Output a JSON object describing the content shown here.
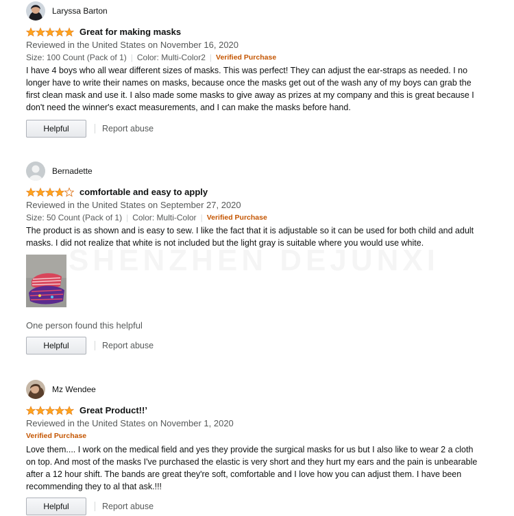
{
  "reviews": [
    {
      "reviewer": "Laryssa Barton",
      "rating": 5,
      "title": "Great for making masks",
      "reviewed": "Reviewed in the United States on November 16, 2020",
      "size": "Size: 100 Count (Pack of 1)",
      "color": "Color: Multi-Color2",
      "verified": "Verified Purchase",
      "body": "I have 4 boys who all wear different sizes of masks. This was perfect! They can adjust the ear-straps as needed. I no longer have to write their names on masks, because once the masks get out of the wash any of my boys can grab the first clean mask and use it. I also made some masks to give away as prizes at my company and this is great because I don't need the winner's exact measurements, and I can make the masks before hand.",
      "helpful_label": "Helpful",
      "report_label": "Report abuse"
    },
    {
      "reviewer": "Bernadette",
      "rating": 4,
      "title": "comfortable and easy to apply",
      "reviewed": "Reviewed in the United States on September 27, 2020",
      "size": "Size: 50 Count (Pack of 1)",
      "color": "Color: Multi-Color",
      "verified": "Verified Purchase",
      "body": "The product is as shown and is easy to sew. I like the fact that it is adjustable so it can be used for both child and adult masks. I did not realize that white is not included but the light gray is suitable where you would use white.",
      "helpful_count": "One person found this helpful",
      "helpful_label": "Helpful",
      "report_label": "Report abuse"
    },
    {
      "reviewer": "Mz Wendee",
      "rating": 5,
      "title": "Great Product!!’",
      "reviewed": "Reviewed in the United States on November 1, 2020",
      "verified": "Verified Purchase",
      "body": "Love them.... I work on the medical field and yes they provide the surgical masks for us but I also like to wear 2 a cloth on top. And most of the masks I've purchased the elastic is very short and they hurt my ears and the pain is unbearable after a 12 hour shift. The bands are great they're soft, comfortable and I love how you can adjust them. I have been recommending they to al that ask.!!!",
      "helpful_label": "Helpful",
      "report_label": "Report abuse"
    }
  ],
  "watermark": "SHENZHEN DEJUNXI",
  "colors": {
    "star": "#ffa41c",
    "verified": "#c45500",
    "meta": "#565959"
  }
}
